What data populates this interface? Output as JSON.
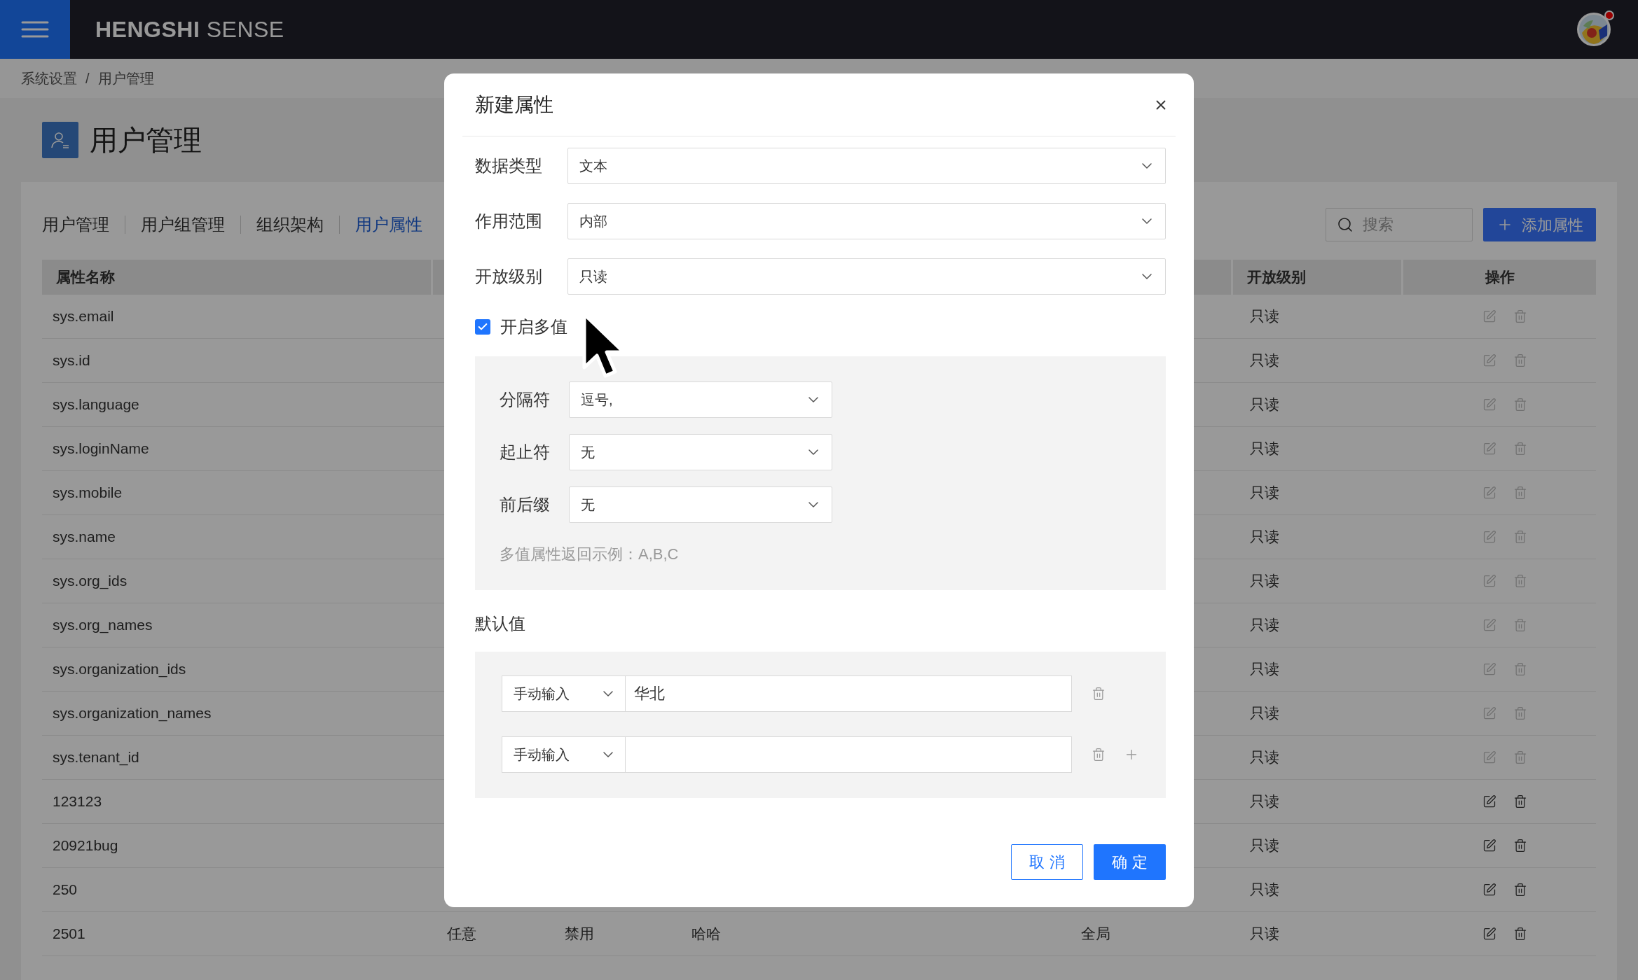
{
  "topbar": {
    "brand_bold": "HENGSHI",
    "brand_light": "SENSE",
    "notification": true
  },
  "breadcrumb": [
    "系统设置",
    "/",
    "用户管理"
  ],
  "page_title": "用户管理",
  "tabs": [
    {
      "label": "用户管理",
      "selected": false
    },
    {
      "label": "用户组管理",
      "selected": false
    },
    {
      "label": "组织架构",
      "selected": false
    },
    {
      "label": "用户属性",
      "selected": true
    }
  ],
  "search": {
    "placeholder": "搜索"
  },
  "add_button": "添加属性",
  "table": {
    "columns": [
      "属性名称",
      "开放级别",
      "操作"
    ],
    "rows": [
      {
        "name": "sys.email",
        "cells": [],
        "level": "只读",
        "actions_disabled": true
      },
      {
        "name": "sys.id",
        "cells": [],
        "level": "只读",
        "actions_disabled": true
      },
      {
        "name": "sys.language",
        "cells": [],
        "level": "只读",
        "actions_disabled": true
      },
      {
        "name": "sys.loginName",
        "cells": [],
        "level": "只读",
        "actions_disabled": true
      },
      {
        "name": "sys.mobile",
        "cells": [],
        "level": "只读",
        "actions_disabled": true
      },
      {
        "name": "sys.name",
        "cells": [],
        "level": "只读",
        "actions_disabled": true
      },
      {
        "name": "sys.org_ids",
        "cells": [],
        "level": "只读",
        "actions_disabled": true
      },
      {
        "name": "sys.org_names",
        "cells": [],
        "level": "只读",
        "actions_disabled": true
      },
      {
        "name": "sys.organization_ids",
        "cells": [],
        "level": "只读",
        "actions_disabled": true
      },
      {
        "name": "sys.organization_names",
        "cells": [],
        "level": "只读",
        "actions_disabled": true
      },
      {
        "name": "sys.tenant_id",
        "cells": [],
        "level": "只读",
        "actions_disabled": true
      },
      {
        "name": "123123",
        "cells": [],
        "level": "只读",
        "actions_disabled": false
      },
      {
        "name": "20921bug",
        "cells": [],
        "level": "只读",
        "actions_disabled": false
      },
      {
        "name": "250",
        "cells": [],
        "level": "只读",
        "actions_disabled": false
      },
      {
        "name": "2501",
        "cells": [
          "任意",
          "禁用",
          "哈哈",
          "全局"
        ],
        "level": "只读",
        "actions_disabled": false
      }
    ]
  },
  "dialog": {
    "title": "新建属性",
    "fields": [
      {
        "label": "数据类型",
        "value": "文本"
      },
      {
        "label": "作用范围",
        "value": "内部"
      },
      {
        "label": "开放级别",
        "value": "只读"
      }
    ],
    "multi_value": {
      "label": "开启多值",
      "checked": true
    },
    "multi_fields": [
      {
        "label": "分隔符",
        "value": "逗号,"
      },
      {
        "label": "起止符",
        "value": "无"
      },
      {
        "label": "前后缀",
        "value": "无"
      }
    ],
    "multi_hint": "多值属性返回示例：A,B,C",
    "default_label": "默认值",
    "defaults": [
      {
        "source": "手动输入",
        "value": "华北",
        "addable": false
      },
      {
        "source": "手动输入",
        "addable": true
      }
    ],
    "buttons": [
      {
        "label": "取 消",
        "kind": "secondary"
      },
      {
        "label": "确 定",
        "kind": "primary"
      }
    ]
  }
}
